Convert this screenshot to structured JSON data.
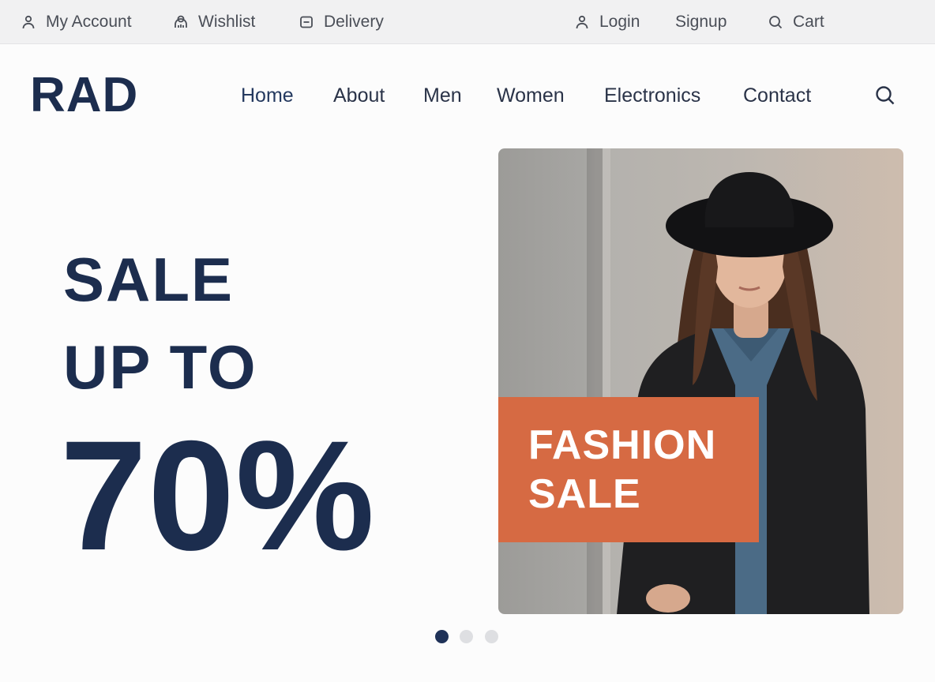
{
  "topbar": {
    "my_account": "My Account",
    "wishlist": "Wishlist",
    "delivery": "Delivery",
    "login": "Login",
    "signup": "Signup",
    "cart": "Cart"
  },
  "header": {
    "logo": "RAD",
    "nav": [
      "Home",
      "About",
      "Men",
      "Women",
      "Electronics",
      "Contact"
    ]
  },
  "hero": {
    "line1": "SALE",
    "line2": "UP TO",
    "big": "70%",
    "badge_line1": "FASHION",
    "badge_line2": "SALE",
    "active_slide": 1,
    "slide_count": 3
  },
  "colors": {
    "brand_navy": "#1c2d4e",
    "badge_orange": "#d66a43",
    "dot_inactive": "#dedfe2"
  }
}
